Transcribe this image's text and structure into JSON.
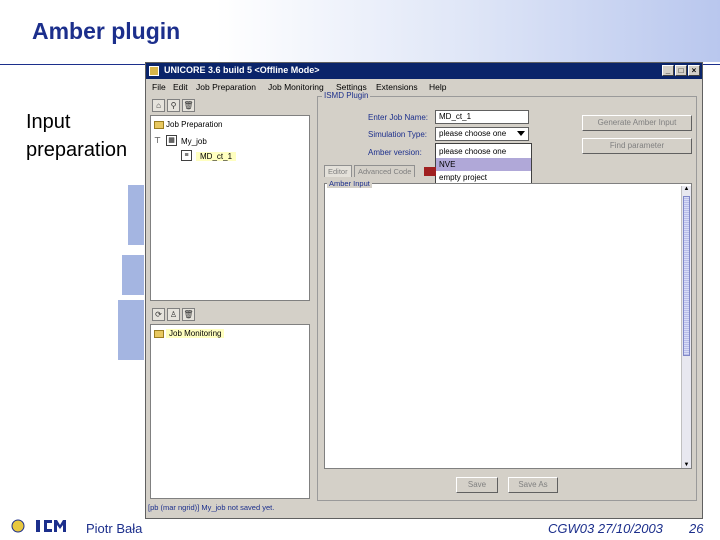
{
  "slide": {
    "title": "Amber plugin",
    "side_label_1": "Input",
    "side_label_2": "preparation",
    "footer_author": "Piotr Bała",
    "footer_conference": "CGW03 27/10/2003",
    "page_number": "26"
  },
  "window": {
    "title": "UNICORE 3.6 build 5 <Offline Mode>",
    "menu": [
      "File",
      "Edit",
      "Job Preparation",
      "Job Monitoring",
      "Settings",
      "Extensions",
      "Help"
    ]
  },
  "job_tree": {
    "root": "Job Preparation",
    "job": "My_job",
    "task": "MD_ct_1"
  },
  "monitor_tree": {
    "root": "Job Monitoring"
  },
  "plugin": {
    "frame_title": "ISMD Plugin",
    "job_name_label": "Enter Job Name:",
    "job_name_value": "MD_ct_1",
    "sim_type_label": "Simulation Type:",
    "sim_type_value": "please choose one",
    "amber_version_label": "Amber version:",
    "dropdown_options": [
      "please choose one",
      "NVE",
      "empty project"
    ],
    "generate_button": "Generate Amber Input",
    "find_button": "Find parameter",
    "tabs": [
      "Editor",
      "Advanced Code"
    ],
    "editor_title": "Amber Input",
    "save_button": "Save",
    "save_as_button": "Save As"
  },
  "status": "[pb (mar ngrid)] My_job not saved yet."
}
